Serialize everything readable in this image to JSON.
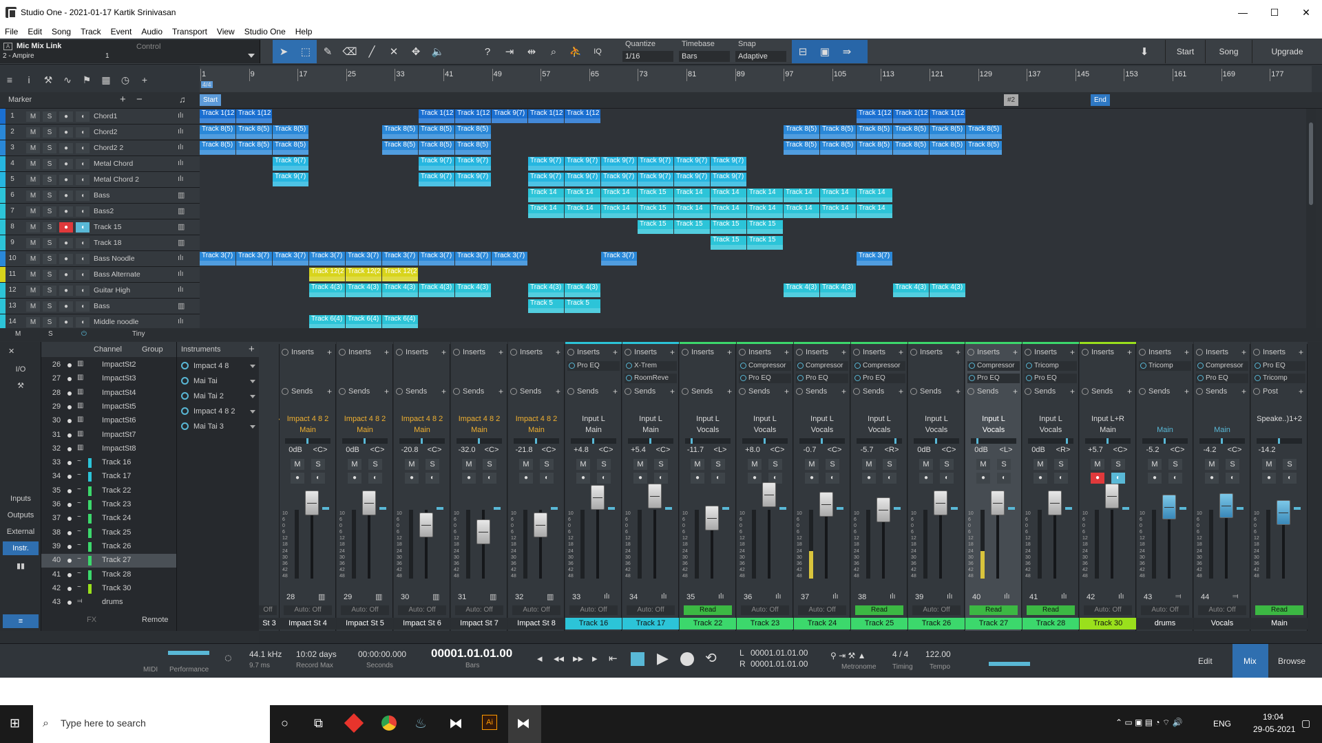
{
  "window": {
    "title": "Studio One - 2021-01-17 Kartik Srinivasan",
    "minimize": "—",
    "maximize": "☐",
    "close": "✕"
  },
  "menu": [
    "File",
    "Edit",
    "Song",
    "Track",
    "Event",
    "Audio",
    "Transport",
    "View",
    "Studio One",
    "Help"
  ],
  "toolbar": {
    "mic_link": "Mic Mix Link",
    "device": "2 - Ampire",
    "device_num": "1",
    "control": "Control",
    "a_badge": "A",
    "quantize_label": "Quantize",
    "quantize_value": "1/16",
    "timebase_label": "Timebase",
    "timebase_value": "Bars",
    "snap_label": "Snap",
    "snap_value": "Adaptive",
    "iq": "IQ",
    "start": "Start",
    "song": "Song",
    "upgrade": "Upgrade"
  },
  "arranger": {
    "ruler": [
      "1",
      "9",
      "17",
      "25",
      "33",
      "41",
      "49",
      "57",
      "65",
      "73",
      "81",
      "89",
      "97",
      "105",
      "113",
      "121",
      "129",
      "137",
      "145",
      "153",
      "161",
      "169",
      "177"
    ],
    "time_sig": "4/4",
    "marker_label": "Marker",
    "markers": {
      "start": "Start",
      "num": "#2",
      "end": "End"
    },
    "footer": {
      "m": "M",
      "s": "S",
      "size": "Tiny"
    }
  },
  "tracks": [
    {
      "n": "1",
      "name": "Chord1",
      "color": "#1a6fd1",
      "icon": "ılı"
    },
    {
      "n": "2",
      "name": "Chord2",
      "color": "#2a88d8",
      "icon": "ılı"
    },
    {
      "n": "3",
      "name": "Chord2 2",
      "color": "#2a88d8",
      "icon": "ılı"
    },
    {
      "n": "4",
      "name": "Metal Chord",
      "color": "#26b6e0",
      "icon": "ılı"
    },
    {
      "n": "5",
      "name": "Metal Chord 2",
      "color": "#26b6e0",
      "icon": "ılı"
    },
    {
      "n": "6",
      "name": "Bass",
      "color": "#2cc4d8",
      "icon": "▥"
    },
    {
      "n": "7",
      "name": "Bass2",
      "color": "#2cc4d8",
      "icon": "▥"
    },
    {
      "n": "8",
      "name": "Track 15",
      "color": "#2cc4d8",
      "icon": "▥"
    },
    {
      "n": "9",
      "name": "Track 18",
      "color": "#2cc4d8",
      "icon": "▥"
    },
    {
      "n": "10",
      "name": "Bass Noodle",
      "color": "#2a88d8",
      "icon": "ılı"
    },
    {
      "n": "11",
      "name": "Bass Alternate",
      "color": "#d8d41c",
      "icon": "ılı"
    },
    {
      "n": "12",
      "name": "Guitar High",
      "color": "#2cc4d8",
      "icon": "ılı"
    },
    {
      "n": "13",
      "name": "Bass",
      "color": "#2cc4d8",
      "icon": "▥"
    },
    {
      "n": "14",
      "name": "Middle noodle",
      "color": "#2cc4d8",
      "icon": "ılı"
    }
  ],
  "track_buttons": {
    "m": "M",
    "s": "S",
    "rec": "●",
    "mon": "◖"
  },
  "events": [
    {
      "row": 0,
      "label": "Track 1(12",
      "color": "#1a6fd1",
      "starts": [
        0,
        53
      ],
      "w": 53
    },
    {
      "row": 0,
      "label": "Track 1(12",
      "color": "#1a6fd1",
      "starts": [
        318,
        371
      ],
      "w": 53
    },
    {
      "row": 0,
      "label": "Track 9(7)",
      "color": "#1a6fd1",
      "starts": [
        424
      ],
      "w": 53
    },
    {
      "row": 0,
      "label": "Track 1(12",
      "color": "#1a6fd1",
      "starts": [
        477,
        530,
        954,
        1007,
        1060
      ],
      "w": 53
    },
    {
      "row": 1,
      "label": "Track 8(5)",
      "color": "#2a88d8",
      "starts": [
        0,
        53,
        106,
        265,
        318,
        371,
        848,
        901,
        954,
        1007,
        1060,
        1113
      ],
      "w": 53
    },
    {
      "row": 2,
      "label": "Track 8(5)",
      "color": "#2a88d8",
      "starts": [
        0,
        53,
        106,
        265,
        318,
        371,
        848,
        901,
        954,
        1007,
        1060,
        1113
      ],
      "w": 53
    },
    {
      "row": 3,
      "label": "Track 9(7)",
      "color": "#26b6e0",
      "starts": [
        106,
        318,
        371,
        477,
        530,
        583,
        636,
        689,
        742
      ],
      "w": 53
    },
    {
      "row": 4,
      "label": "Track 9(7)",
      "color": "#26b6e0",
      "starts": [
        106,
        318,
        371,
        477,
        530,
        583,
        636,
        689,
        742
      ],
      "w": 53
    },
    {
      "row": 5,
      "label": "Track 14",
      "color": "#2cc4d8",
      "starts": [
        477,
        530,
        583
      ],
      "w": 53
    },
    {
      "row": 5,
      "label": "Track 15",
      "color": "#2cc4d8",
      "starts": [
        636
      ],
      "w": 53
    },
    {
      "row": 5,
      "label": "Track 14",
      "color": "#2cc4d8",
      "starts": [
        689,
        742,
        795,
        848,
        901,
        954
      ],
      "w": 53
    },
    {
      "row": 6,
      "label": "Track 14",
      "color": "#2cc4d8",
      "starts": [
        477,
        530,
        583
      ],
      "w": 53
    },
    {
      "row": 6,
      "label": "Track 15",
      "color": "#2cc4d8",
      "starts": [
        636
      ],
      "w": 53
    },
    {
      "row": 6,
      "label": "Track 14",
      "color": "#2cc4d8",
      "starts": [
        689,
        742,
        795,
        848,
        901,
        954
      ],
      "w": 53
    },
    {
      "row": 7,
      "label": "Track 15",
      "color": "#2cc4d8",
      "starts": [
        636,
        689,
        742,
        795
      ],
      "w": 53
    },
    {
      "row": 8,
      "label": "Track 15",
      "color": "#2cc4d8",
      "starts": [
        742,
        795
      ],
      "w": 53
    },
    {
      "row": 9,
      "label": "Track 3(7)",
      "color": "#2a88d8",
      "starts": [
        0,
        53,
        106,
        159,
        212,
        265,
        318,
        371,
        424,
        583,
        954
      ],
      "w": 53
    },
    {
      "row": 10,
      "label": "Track 12(2",
      "color": "#d8d41c",
      "starts": [
        159,
        212,
        265
      ],
      "w": 53
    },
    {
      "row": 11,
      "label": "Track 4(3)",
      "color": "#2cc4d8",
      "starts": [
        159,
        212,
        265,
        318,
        371,
        477,
        530,
        848,
        901,
        1007,
        1060
      ],
      "w": 53
    },
    {
      "row": 12,
      "label": "Track 5",
      "color": "#2cc4d8",
      "starts": [
        477,
        530
      ],
      "w": 53
    },
    {
      "row": 13,
      "label": "Track 6(4)",
      "color": "#2cc4d8",
      "starts": [
        159,
        212,
        265
      ],
      "w": 53
    }
  ],
  "mixer_left": {
    "io": "I/O",
    "inputs": "Inputs",
    "outputs": "Outputs",
    "external": "External",
    "instr": "Instr."
  },
  "channel_list": {
    "header_channel": "Channel",
    "header_group": "Group",
    "rows": [
      {
        "n": "26",
        "typ": "▥",
        "name": "ImpactSt2",
        "sw": ""
      },
      {
        "n": "27",
        "typ": "▥",
        "name": "ImpactSt3",
        "sw": ""
      },
      {
        "n": "28",
        "typ": "▥",
        "name": "ImpactSt4",
        "sw": ""
      },
      {
        "n": "29",
        "typ": "▥",
        "name": "ImpactSt5",
        "sw": ""
      },
      {
        "n": "30",
        "typ": "▥",
        "name": "ImpactSt6",
        "sw": ""
      },
      {
        "n": "31",
        "typ": "▥",
        "name": "ImpactSt7",
        "sw": ""
      },
      {
        "n": "32",
        "typ": "▥",
        "name": "ImpactSt8",
        "sw": ""
      },
      {
        "n": "33",
        "typ": "~",
        "name": "Track 16",
        "sw": "#2cc4d8"
      },
      {
        "n": "34",
        "typ": "~",
        "name": "Track 17",
        "sw": "#2cc4d8"
      },
      {
        "n": "35",
        "typ": "~",
        "name": "Track 22",
        "sw": "#3cd86c"
      },
      {
        "n": "36",
        "typ": "~",
        "name": "Track 23",
        "sw": "#3cd86c"
      },
      {
        "n": "37",
        "typ": "~",
        "name": "Track 24",
        "sw": "#3cd86c"
      },
      {
        "n": "38",
        "typ": "~",
        "name": "Track 25",
        "sw": "#3cd86c"
      },
      {
        "n": "39",
        "typ": "~",
        "name": "Track 26",
        "sw": "#3cd86c"
      },
      {
        "n": "40",
        "typ": "~",
        "name": "Track 27",
        "sw": "#3cd86c"
      },
      {
        "n": "41",
        "typ": "~",
        "name": "Track 28",
        "sw": "#3cd86c"
      },
      {
        "n": "42",
        "typ": "~",
        "name": "Track 30",
        "sw": "#9ae01c"
      },
      {
        "n": "43",
        "typ": "⫤",
        "name": "drums",
        "sw": ""
      }
    ],
    "remote": "Remote",
    "fx": "FX"
  },
  "instruments": {
    "header": "Instruments",
    "items": [
      "Impact 4 8",
      "Mai Tai",
      "Mai Tai 2",
      "Impact 4 8 2",
      "Mai Tai 3"
    ]
  },
  "strips": [
    {
      "partial": true,
      "num": "",
      "io_a": "4 8 2",
      "io_b": "n",
      "vol": "",
      "pan": "<C>",
      "name": "St 3",
      "auto": "Off",
      "io_color": "#f0b030",
      "name_bg": "#2b2f33",
      "top": "#33383d",
      "plugs": [],
      "fader": 256,
      "inslabel": ""
    },
    {
      "num": "28",
      "io_a": "Impact 4 8 2",
      "io_b": "Main",
      "vol": "0dB",
      "pan": "<C>",
      "name": "Impact St 4",
      "auto": "Auto: Off",
      "io_color": "#f0b030",
      "name_bg": "#2b2f33",
      "top": "#33383d",
      "plugs": [],
      "fader": 256,
      "icon": "▥"
    },
    {
      "num": "29",
      "io_a": "Impact 4 8 2",
      "io_b": "Main",
      "vol": "0dB",
      "pan": "<C>",
      "name": "Impact St 5",
      "auto": "Auto: Off",
      "io_color": "#f0b030",
      "name_bg": "#2b2f33",
      "top": "#33383d",
      "plugs": [],
      "fader": 256,
      "icon": "▥"
    },
    {
      "num": "30",
      "io_a": "Impact 4 8 2",
      "io_b": "Main",
      "vol": "-20.8",
      "pan": "<C>",
      "name": "Impact St 6",
      "auto": "Auto: Off",
      "io_color": "#f0b030",
      "name_bg": "#2b2f33",
      "top": "#33383d",
      "plugs": [],
      "fader": 288,
      "icon": "▥"
    },
    {
      "num": "31",
      "io_a": "Impact 4 8 2",
      "io_b": "Main",
      "vol": "-32.0",
      "pan": "<C>",
      "name": "Impact St 7",
      "auto": "Auto: Off",
      "io_color": "#f0b030",
      "name_bg": "#2b2f33",
      "top": "#33383d",
      "plugs": [],
      "fader": 298,
      "icon": "▥"
    },
    {
      "num": "32",
      "io_a": "Impact 4 8 2",
      "io_b": "Main",
      "vol": "-21.8",
      "pan": "<C>",
      "name": "Impact St 8",
      "auto": "Auto: Off",
      "io_color": "#f0b030",
      "name_bg": "#2b2f33",
      "top": "#33383d",
      "plugs": [],
      "fader": 288,
      "icon": "▥"
    },
    {
      "num": "33",
      "io_a": "Input L",
      "io_b": "Main",
      "vol": "+4.8",
      "pan": "<C>",
      "name": "Track 16",
      "auto": "Auto: Off",
      "io_color": "#ddd",
      "name_bg": "#2cc4d8",
      "top": "#2cc4d8",
      "plugs": [
        "Pro EQ"
      ],
      "fader": 248,
      "icon": "ılı"
    },
    {
      "num": "34",
      "io_a": "Input L",
      "io_b": "Main",
      "vol": "+5.4",
      "pan": "<C>",
      "name": "Track 17",
      "auto": "Auto: Off",
      "io_color": "#ddd",
      "name_bg": "#2cc4d8",
      "top": "#2cc4d8",
      "plugs": [
        "X-Trem",
        "RoomReve"
      ],
      "fader": 246,
      "icon": "ılı"
    },
    {
      "num": "35",
      "io_a": "Input L",
      "io_b": "Vocals",
      "vol": "-11.7",
      "pan": "<L>",
      "name": "Track 22",
      "auto": "Read",
      "io_color": "#ddd",
      "name_bg": "#3cd86c",
      "top": "#3cd86c",
      "plugs": [],
      "fader": 278,
      "icon": "ılı"
    },
    {
      "num": "36",
      "io_a": "Input L",
      "io_b": "Vocals",
      "vol": "+8.0",
      "pan": "<C>",
      "name": "Track 23",
      "auto": "Auto: Off",
      "io_color": "#ddd",
      "name_bg": "#3cd86c",
      "top": "#3cd86c",
      "plugs": [
        "Compressor",
        "Pro EQ"
      ],
      "fader": 244,
      "icon": "ılı"
    },
    {
      "num": "37",
      "io_a": "Input L",
      "io_b": "Vocals",
      "vol": "-0.7",
      "pan": "<C>",
      "name": "Track 24",
      "auto": "Auto: Off",
      "io_color": "#ddd",
      "name_bg": "#3cd86c",
      "top": "#3cd86c",
      "plugs": [
        "Compressor",
        "Pro EQ"
      ],
      "fader": 258,
      "icon": "ılı"
    },
    {
      "num": "38",
      "io_a": "Input L",
      "io_b": "Vocals",
      "vol": "-5.7",
      "pan": "<R>",
      "name": "Track 25",
      "auto": "Read",
      "io_color": "#ddd",
      "name_bg": "#3cd86c",
      "top": "#3cd86c",
      "plugs": [
        "Compressor",
        "Pro EQ"
      ],
      "fader": 266,
      "icon": "ılı"
    },
    {
      "num": "39",
      "io_a": "Input L",
      "io_b": "Vocals",
      "vol": "0dB",
      "pan": "<C>",
      "name": "Track 26",
      "auto": "Auto: Off",
      "io_color": "#ddd",
      "name_bg": "#3cd86c",
      "top": "#3cd86c",
      "plugs": [],
      "fader": 256,
      "icon": "ılı"
    },
    {
      "num": "40",
      "io_a": "Input L",
      "io_b": "Vocals",
      "vol": "0dB",
      "pan": "<L>",
      "name": "Track 27",
      "auto": "Read",
      "io_color": "#fff",
      "name_bg": "#3cd86c",
      "top": "#3cd86c",
      "plugs": [
        "Compressor",
        "Pro EQ"
      ],
      "fader": 256,
      "sel": true,
      "icon": "ılı"
    },
    {
      "num": "41",
      "io_a": "Input L",
      "io_b": "Vocals",
      "vol": "0dB",
      "pan": "<R>",
      "name": "Track 28",
      "auto": "Read",
      "io_color": "#ddd",
      "name_bg": "#3cd86c",
      "top": "#3cd86c",
      "plugs": [
        "Tricomp",
        "Pro EQ"
      ],
      "fader": 256,
      "icon": "ılı"
    },
    {
      "num": "42",
      "io_a": "Input L+R",
      "io_b": "Main",
      "vol": "+5.7",
      "pan": "<C>",
      "name": "Track 30",
      "auto": "Auto: Off",
      "io_color": "#ddd",
      "name_bg": "#9ae01c",
      "top": "#9ae01c",
      "plugs": [],
      "fader": 246,
      "rec": true,
      "icon": "ılı"
    },
    {
      "num": "43",
      "io_a": "",
      "io_b": "Main",
      "vol": "-5.2",
      "pan": "<C>",
      "name": "drums",
      "auto": "Auto: Off",
      "io_color": "#59b8d6",
      "name_bg": "#2b2f33",
      "top": "#33383d",
      "plugs": [
        "Tricomp"
      ],
      "fader": 262,
      "bus": true,
      "icon": "⫤"
    },
    {
      "num": "44",
      "io_a": "",
      "io_b": "Main",
      "vol": "-4.2",
      "pan": "<C>",
      "name": "Vocals",
      "auto": "Auto: Off",
      "io_color": "#59b8d6",
      "name_bg": "#2b2f33",
      "top": "#33383d",
      "plugs": [
        "Compressor",
        "Pro EQ"
      ],
      "fader": 260,
      "bus": true,
      "icon": "⫤"
    },
    {
      "num": "",
      "io_a": "Speake..)1+2",
      "io_b": "",
      "vol": "-14.2",
      "pan": "",
      "name": "Main",
      "auto": "Read",
      "io_color": "#ddd",
      "name_bg": "#2b2f33",
      "top": "#33383d",
      "plugs": [
        "Pro EQ",
        "Tricomp"
      ],
      "fader": 270,
      "bus": true,
      "main": true,
      "icon": ""
    }
  ],
  "strip_labels": {
    "inserts": "Inserts",
    "sends": "Sends",
    "post": "Post",
    "m": "M",
    "s": "S",
    "plus": "+"
  },
  "meter_scale": [
    "10",
    "6",
    "0",
    "6",
    "12",
    "18",
    "24",
    "30",
    "36",
    "42",
    "48"
  ],
  "transport": {
    "midi": "MIDI",
    "performance": "Performance",
    "rate": "44.1 kHz",
    "latency": "9.7 ms",
    "record_max_val": "10:02 days",
    "record_max": "Record Max",
    "seconds_val": "00:00:00.000",
    "seconds": "Seconds",
    "bars_val": "00001.01.01.00",
    "bars": "Bars",
    "l": "L",
    "r": "R",
    "loop_l": "00001.01.01.00",
    "loop_r": "00001.01.01.00",
    "metronome": "Metronome",
    "timing_val": "4 / 4",
    "timing": "Timing",
    "tempo_val": "122.00",
    "tempo": "Tempo",
    "edit": "Edit",
    "mix": "Mix",
    "browse": "Browse"
  },
  "taskbar": {
    "search": "Type here to search",
    "lang": "ENG",
    "time": "19:04",
    "date": "29-05-2021"
  }
}
